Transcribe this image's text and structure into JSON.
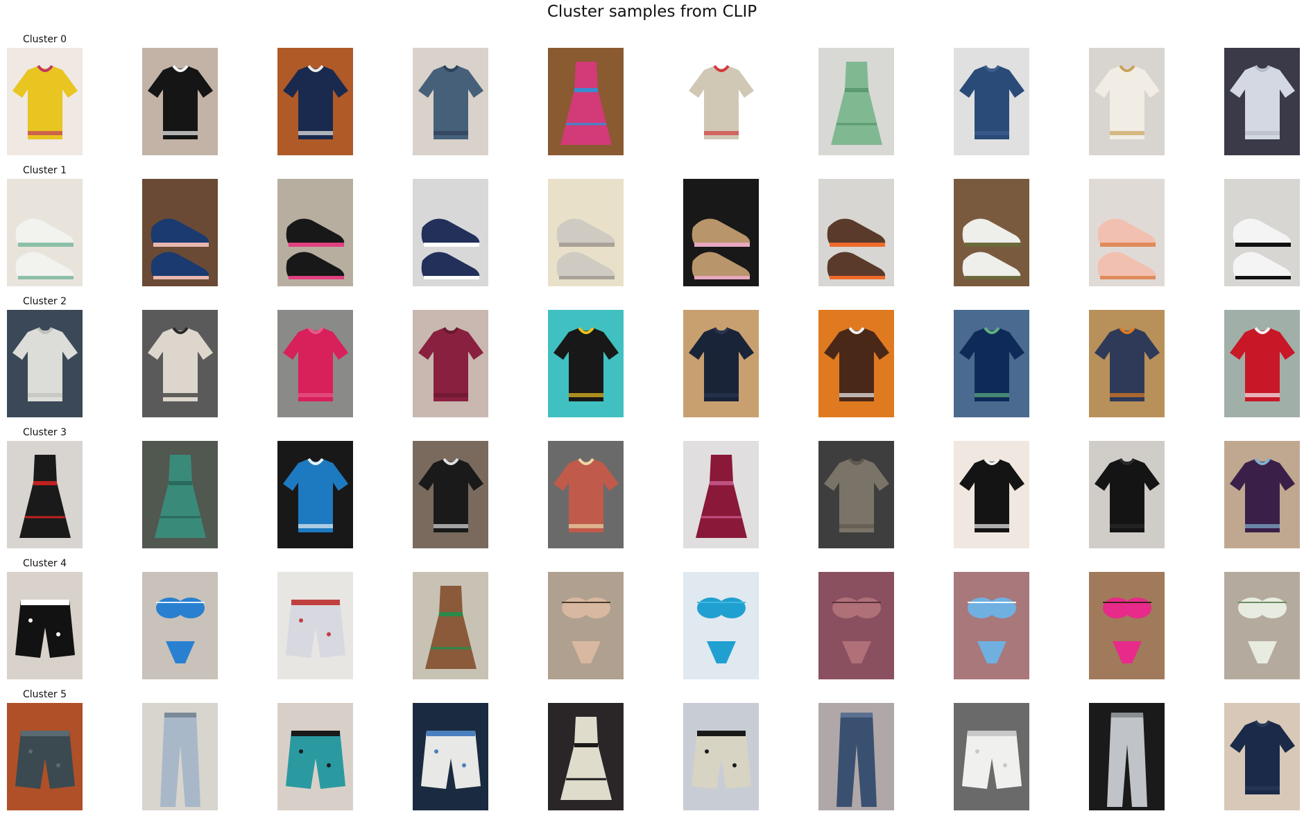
{
  "title": "Cluster samples from CLIP",
  "clusters": [
    {
      "label": "Cluster 0",
      "items": [
        {
          "kind": "top",
          "bg": "#efe8e3",
          "main": "#e8c520",
          "accent": "#c03a60"
        },
        {
          "kind": "top",
          "bg": "#c2b3a6",
          "main": "#151515",
          "accent": "#f5f5f5"
        },
        {
          "kind": "top",
          "bg": "#b05a28",
          "main": "#1a2a4e",
          "accent": "#f0ece6"
        },
        {
          "kind": "top",
          "bg": "#d9d2cb",
          "main": "#46607a",
          "accent": "#2d4259"
        },
        {
          "kind": "dress",
          "bg": "#8a5a30",
          "main": "#d23a78",
          "accent": "#3a8ad0"
        },
        {
          "kind": "top",
          "bg": "#ffffff",
          "main": "#d0c8b5",
          "accent": "#d23a3a"
        },
        {
          "kind": "dress",
          "bg": "#d8d8d5",
          "main": "#80b892",
          "accent": "#5c9a70"
        },
        {
          "kind": "top",
          "bg": "#e0e0e0",
          "main": "#2a4b78",
          "accent": "#3d5e8e"
        },
        {
          "kind": "top",
          "bg": "#d8d5d0",
          "main": "#f1ede4",
          "accent": "#c9a35a"
        },
        {
          "kind": "top",
          "bg": "#3a3a48",
          "main": "#d4d8e2",
          "accent": "#b7bcc8"
        }
      ]
    },
    {
      "label": "Cluster 1",
      "items": [
        {
          "kind": "shoe",
          "bg": "#e8e4dc",
          "main": "#f2f2ef",
          "accent": "#8cbfa8"
        },
        {
          "kind": "shoe",
          "bg": "#6a4a35",
          "main": "#1a3a70",
          "accent": "#e8b8b0"
        },
        {
          "kind": "shoe",
          "bg": "#b8aea0",
          "main": "#181818",
          "accent": "#e04080"
        },
        {
          "kind": "shoe",
          "bg": "#d8d8d8",
          "main": "#22305a",
          "accent": "#ffffff"
        },
        {
          "kind": "shoe",
          "bg": "#e8e0c8",
          "main": "#cfcac2",
          "accent": "#a8a29a"
        },
        {
          "kind": "shoe",
          "bg": "#181818",
          "main": "#b8956a",
          "accent": "#e8a8c0"
        },
        {
          "kind": "shoe",
          "bg": "#d8d6d2",
          "main": "#5a3a2a",
          "accent": "#f06a2a"
        },
        {
          "kind": "shoe",
          "bg": "#7a5a3e",
          "main": "#eeeeea",
          "accent": "#6a6a3a"
        },
        {
          "kind": "shoe",
          "bg": "#e0dad6",
          "main": "#f2c0b0",
          "accent": "#e08a5a"
        },
        {
          "kind": "shoe",
          "bg": "#d8d6d2",
          "main": "#f4f4f4",
          "accent": "#111111"
        }
      ]
    },
    {
      "label": "Cluster 2",
      "items": [
        {
          "kind": "top",
          "bg": "#3a4858",
          "main": "#dcdcd8",
          "accent": "#c0c0bb"
        },
        {
          "kind": "top",
          "bg": "#5a5a5a",
          "main": "#dcd6cc",
          "accent": "#2a2a2a"
        },
        {
          "kind": "top",
          "bg": "#8a8a88",
          "main": "#d8205a",
          "accent": "#e85a8a"
        },
        {
          "kind": "top",
          "bg": "#c8b8b0",
          "main": "#8a2040",
          "accent": "#6a1830"
        },
        {
          "kind": "top",
          "bg": "#40c0c0",
          "main": "#181818",
          "accent": "#e8c020"
        },
        {
          "kind": "top",
          "bg": "#c8a070",
          "main": "#1a2438",
          "accent": "#2a3450"
        },
        {
          "kind": "top",
          "bg": "#e07a20",
          "main": "#4a2818",
          "accent": "#f0f0f0"
        },
        {
          "kind": "top",
          "bg": "#4a6a90",
          "main": "#0e2a58",
          "accent": "#60b080"
        },
        {
          "kind": "top",
          "bg": "#b8905a",
          "main": "#2e3a58",
          "accent": "#e07a20"
        },
        {
          "kind": "top",
          "bg": "#a0b0a8",
          "main": "#c81828",
          "accent": "#f4f4f4"
        }
      ]
    },
    {
      "label": "Cluster 3",
      "items": [
        {
          "kind": "dress",
          "bg": "#d8d4d0",
          "main": "#1a1a1a",
          "accent": "#c02020"
        },
        {
          "kind": "dress",
          "bg": "#505850",
          "main": "#3a8a7a",
          "accent": "#2a6a5a"
        },
        {
          "kind": "top",
          "bg": "#181818",
          "main": "#1e7ac0",
          "accent": "#e8f0f4"
        },
        {
          "kind": "top",
          "bg": "#7a6a5e",
          "main": "#1a1a1a",
          "accent": "#e0e0e0"
        },
        {
          "kind": "top",
          "bg": "#6a6a6a",
          "main": "#c05a4a",
          "accent": "#e8d8a8"
        },
        {
          "kind": "dress",
          "bg": "#e0dede",
          "main": "#8a1838",
          "accent": "#c05080"
        },
        {
          "kind": "top",
          "bg": "#3e3e3e",
          "main": "#7a7468",
          "accent": "#5e5850"
        },
        {
          "kind": "top",
          "bg": "#f0e8e0",
          "main": "#141414",
          "accent": "#f0f0f0"
        },
        {
          "kind": "top",
          "bg": "#d0ccc8",
          "main": "#141414",
          "accent": "#2a2a2a"
        },
        {
          "kind": "top",
          "bg": "#c0a890",
          "main": "#3a2048",
          "accent": "#80b0d0"
        }
      ]
    },
    {
      "label": "Cluster 4",
      "items": [
        {
          "kind": "shorts",
          "bg": "#d8d2ca",
          "main": "#121212",
          "accent": "#ffffff"
        },
        {
          "kind": "swim",
          "bg": "#c8c2ba",
          "main": "#2a80d0",
          "accent": "#e0f0f8"
        },
        {
          "kind": "shorts",
          "bg": "#e8e6e2",
          "main": "#d8d8e0",
          "accent": "#c04040"
        },
        {
          "kind": "dress",
          "bg": "#c8c2b4",
          "main": "#8a5a3a",
          "accent": "#2a8a4a"
        },
        {
          "kind": "swim",
          "bg": "#b0a090",
          "main": "#d8b8a0",
          "accent": "#4a3a30"
        },
        {
          "kind": "swim",
          "bg": "#e0e8f0",
          "main": "#20a0d0",
          "accent": "#40b8e0"
        },
        {
          "kind": "swim",
          "bg": "#8a5060",
          "main": "#b07078",
          "accent": "#5a3040"
        },
        {
          "kind": "swim",
          "bg": "#a8787a",
          "main": "#70b0e0",
          "accent": "#ffffff"
        },
        {
          "kind": "swim",
          "bg": "#a07a5a",
          "main": "#e82a8a",
          "accent": "#3a2418"
        },
        {
          "kind": "swim",
          "bg": "#b4aa9e",
          "main": "#e8ece0",
          "accent": "#6a8a60"
        }
      ]
    },
    {
      "label": "Cluster 5",
      "items": [
        {
          "kind": "shorts",
          "bg": "#b05028",
          "main": "#3a4a50",
          "accent": "#5a6a70"
        },
        {
          "kind": "pants",
          "bg": "#d8d4ce",
          "main": "#a8b8c8",
          "accent": "#7a8a98"
        },
        {
          "kind": "shorts",
          "bg": "#d8d0c8",
          "main": "#2a9aa0",
          "accent": "#1a1a1a"
        },
        {
          "kind": "shorts",
          "bg": "#1a2a40",
          "main": "#e8e8e6",
          "accent": "#4a80c0"
        },
        {
          "kind": "dress",
          "bg": "#2a2628",
          "main": "#e0dccc",
          "accent": "#1a1a1a"
        },
        {
          "kind": "shorts",
          "bg": "#c8ccd4",
          "main": "#d8d4c4",
          "accent": "#1a1a1a"
        },
        {
          "kind": "pants",
          "bg": "#b0a8a8",
          "main": "#3a5070",
          "accent": "#5a7090"
        },
        {
          "kind": "shorts",
          "bg": "#6a6a6a",
          "main": "#f0f0ee",
          "accent": "#c8c8c8"
        },
        {
          "kind": "pants",
          "bg": "#1a1a1a",
          "main": "#c0c4c8",
          "accent": "#8a8e92"
        },
        {
          "kind": "top",
          "bg": "#d8c8b8",
          "main": "#1a2a48",
          "accent": "#2a3a5a"
        }
      ]
    }
  ]
}
